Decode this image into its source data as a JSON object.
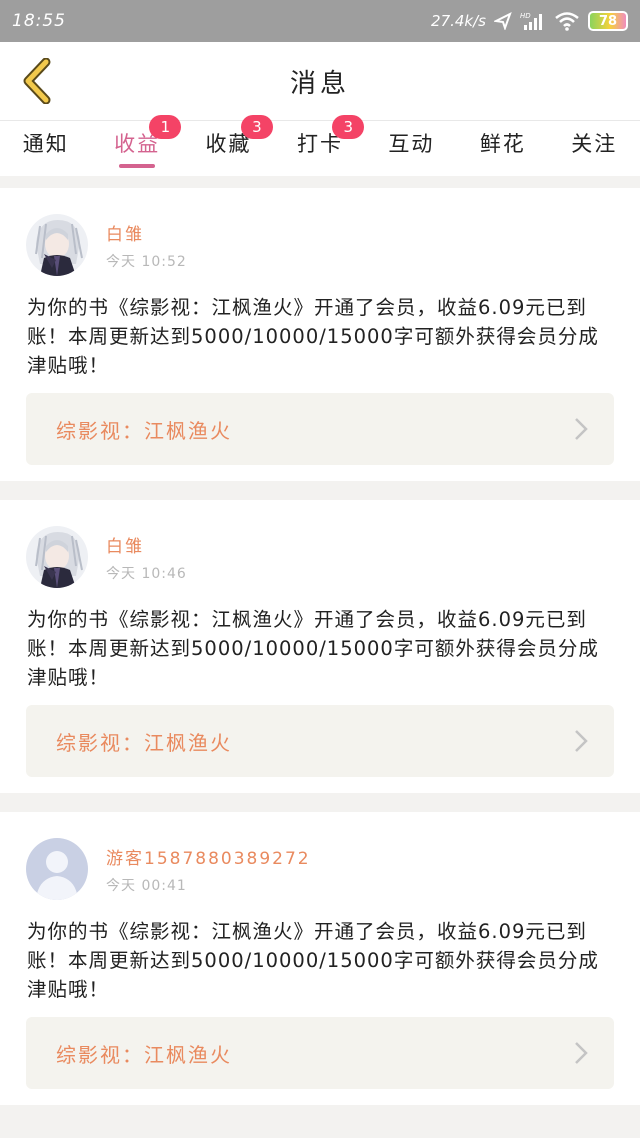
{
  "status_bar": {
    "time": "18:55",
    "network_speed": "27.4k/s",
    "battery": "78"
  },
  "header": {
    "title": "消息",
    "back_icon": "chevron-left-icon"
  },
  "tabs": [
    {
      "label": "通知",
      "badge": ""
    },
    {
      "label": "收益",
      "badge": "1",
      "active": true
    },
    {
      "label": "收藏",
      "badge": "3"
    },
    {
      "label": "打卡",
      "badge": "3"
    },
    {
      "label": "互动",
      "badge": ""
    },
    {
      "label": "鲜花",
      "badge": ""
    },
    {
      "label": "关注",
      "badge": ""
    }
  ],
  "messages": [
    {
      "user_name": "白雏",
      "time": "今天 10:52",
      "text": "为你的书《综影视：江枫渔火》开通了会员，收益6.09元已到账！本周更新达到5000/10000/15000字可额外获得会员分成津贴哦！",
      "book_title": "综影视：江枫渔火",
      "avatar": "anime-avatar"
    },
    {
      "user_name": "白雏",
      "time": "今天 10:46",
      "text": "为你的书《综影视：江枫渔火》开通了会员，收益6.09元已到账！本周更新达到5000/10000/15000字可额外获得会员分成津贴哦！",
      "book_title": "综影视：江枫渔火",
      "avatar": "anime-avatar"
    },
    {
      "user_name": "游客1587880389272",
      "time": "今天 00:41",
      "text": "为你的书《综影视：江枫渔火》开通了会员，收益6.09元已到账！本周更新达到5000/10000/15000字可额外获得会员分成津贴哦！",
      "book_title": "综影视：江枫渔火",
      "avatar": "default-avatar"
    }
  ],
  "colors": {
    "accent_pink": "#d4638f",
    "name_orange": "#e98a5f",
    "badge_red": "#f44366",
    "back_yellow": "#f2c94c"
  }
}
